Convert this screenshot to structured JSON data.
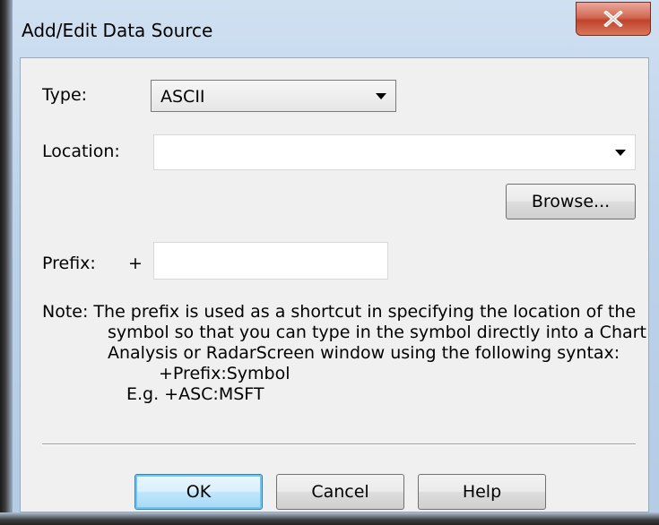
{
  "window": {
    "title": "Add/Edit Data Source",
    "close_glyph": "X"
  },
  "form": {
    "type_label": "Type:",
    "type_value": "ASCII",
    "location_label": "Location:",
    "location_value": "",
    "browse_label": "Browse...",
    "prefix_label": "Prefix:",
    "prefix_plus": "+",
    "prefix_value": ""
  },
  "note": {
    "line1": "Note:  The prefix is used as a shortcut in specifying the location of the",
    "line2": "symbol so that you can type in the symbol directly into a Chart",
    "line3": "Analysis or RadarScreen window using the following syntax:",
    "syntax": "+Prefix:Symbol",
    "example": "E.g. +ASC:MSFT"
  },
  "buttons": {
    "ok": "OK",
    "cancel": "Cancel",
    "help": "Help"
  },
  "icons": {
    "close": "close-icon",
    "dropdown": "chevron-down-icon"
  }
}
